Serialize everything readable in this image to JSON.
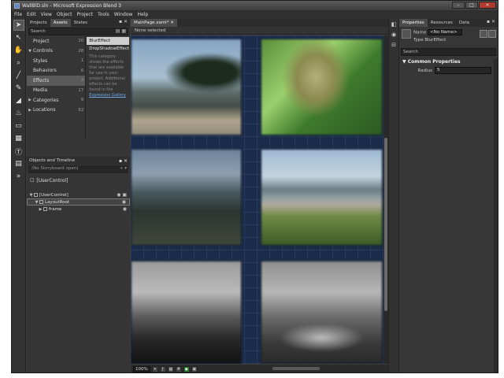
{
  "window": {
    "title": "WallBlD.sln - Microsoft Expression Blend 3",
    "minimize": "–",
    "maximize": "□",
    "close": "✕"
  },
  "menu": [
    "File",
    "Edit",
    "View",
    "Object",
    "Project",
    "Tools",
    "Window",
    "Help"
  ],
  "tools": [
    "selection-icon",
    "direct-select-icon",
    "pan-icon",
    "zoom-icon",
    "eyedropper-icon",
    "pen-icon",
    "paint-bucket-icon",
    "brush-icon",
    "rectangle-icon",
    "grid-icon",
    "text-icon",
    "controls-icon",
    "asset-icon"
  ],
  "left_panel": {
    "tabs": [
      "Projects",
      "Assets",
      "States"
    ],
    "search_placeholder": "Search",
    "categories": [
      {
        "label": "Project",
        "count": "20",
        "arrow": ""
      },
      {
        "label": "Controls",
        "count": "28",
        "arrow": "▼"
      },
      {
        "label": "Styles",
        "count": "1",
        "arrow": ""
      },
      {
        "label": "Behaviors",
        "count": "6",
        "arrow": ""
      },
      {
        "label": "Effects",
        "count": "2",
        "arrow": ""
      },
      {
        "label": "Media",
        "count": "17",
        "arrow": ""
      },
      {
        "label": "Categories",
        "count": "9",
        "arrow": "▶"
      },
      {
        "label": "Locations",
        "count": "82",
        "arrow": "▶"
      }
    ],
    "effects": [
      "BlurEffect",
      "DropShadowEffect"
    ],
    "effect_desc": "This category shows the effects that are available for use in your project. Additional effects can be found in the",
    "effect_link": "Expression Gallery"
  },
  "objects_timeline": {
    "title": "Objects and Timeline",
    "storyboard": "(No Storyboard open)",
    "user_control": "[UserControl]",
    "tree": [
      {
        "label": "[UserControl]",
        "indent": 0
      },
      {
        "label": "LayoutRoot",
        "indent": 1
      },
      {
        "label": "frame",
        "indent": 2
      }
    ]
  },
  "artboard": {
    "tab": "MainPage.xaml*",
    "breadcrumb": "None selected",
    "zoom": "100%"
  },
  "properties": {
    "tabs": [
      "Properties",
      "Resources",
      "Data"
    ],
    "name_label": "Name",
    "name_value": "<No Name>",
    "type_label": "Type",
    "type_value": "BlurEffect",
    "search_placeholder": "Search",
    "section": "Common Properties",
    "radius_label": "Radius",
    "radius_value": "5"
  }
}
